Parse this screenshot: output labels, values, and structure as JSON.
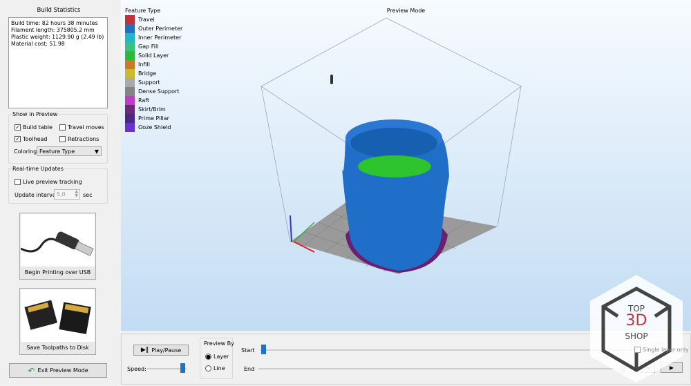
{
  "build_statistics": {
    "title": "Build Statistics",
    "lines": [
      "Build time: 82 hours 38 minutes",
      "Filament length: 375805.2 mm",
      "Plastic weight: 1129.90 g (2.49 lb)",
      "Material cost: 51.98"
    ]
  },
  "show_in_preview": {
    "title": "Show in Preview",
    "build_table": {
      "label": "Build table",
      "checked": true
    },
    "travel_moves": {
      "label": "Travel moves",
      "checked": false
    },
    "toolhead": {
      "label": "Toolhead",
      "checked": true
    },
    "retractions": {
      "label": "Retractions",
      "checked": false
    },
    "coloring_label": "Coloring",
    "coloring_value": "Feature Type"
  },
  "realtime": {
    "title": "Real-time Updates",
    "live_tracking": {
      "label": "Live preview tracking",
      "checked": false
    },
    "interval_label": "Update interval",
    "interval_value": "5,0",
    "interval_unit": "sec"
  },
  "actions": {
    "usb": "Begin Printing over USB",
    "save": "Save Toolpaths to Disk",
    "exit": "Exit Preview Mode"
  },
  "viewport": {
    "mode": "Preview Mode",
    "legend_title": "Feature Type",
    "legend": [
      {
        "label": "Travel",
        "color": "#c2303a"
      },
      {
        "label": "Outer Perimeter",
        "color": "#2270c0"
      },
      {
        "label": "Inner Perimeter",
        "color": "#26b5c6"
      },
      {
        "label": "Gap Fill",
        "color": "#3cc08a"
      },
      {
        "label": "Solid Layer",
        "color": "#2fb83a"
      },
      {
        "label": "Infill",
        "color": "#cc7a2a"
      },
      {
        "label": "Bridge",
        "color": "#c9bb2c"
      },
      {
        "label": "Support",
        "color": "#a9a9a9"
      },
      {
        "label": "Dense Support",
        "color": "#848484"
      },
      {
        "label": "Raft",
        "color": "#c03ac8"
      },
      {
        "label": "Skirt/Brim",
        "color": "#6a2a78"
      },
      {
        "label": "Prime Pillar",
        "color": "#4a2a80"
      },
      {
        "label": "Ooze Shield",
        "color": "#6a34c8"
      }
    ]
  },
  "controls": {
    "play_pause": "Play/Pause",
    "speed_label": "Speed:",
    "speed_value": 0.9,
    "preview_by": "Preview By",
    "layer": "Layer",
    "line": "Line",
    "preview_by_selected": "Layer",
    "start_label": "Start",
    "end_label": "End",
    "start_value": 0,
    "end_value": 1,
    "single_layer": "Single layer only"
  },
  "watermark": {
    "line1": "TOP",
    "line2": "3D",
    "line3": "SHOP"
  }
}
